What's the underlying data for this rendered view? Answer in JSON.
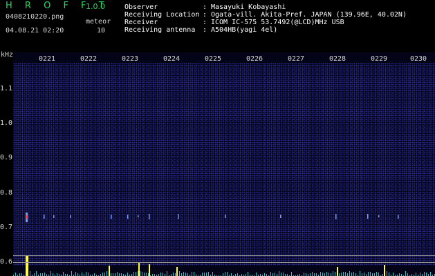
{
  "app": {
    "name": "H R O F F T",
    "version": "1.0.0"
  },
  "file": {
    "name": "0408210220.png",
    "timestamp": "04.08.21 02:20"
  },
  "meteor": {
    "label": "meteor",
    "count": "10"
  },
  "metadata": [
    {
      "label": "Observer",
      "value": "Masayuki Kobayashi"
    },
    {
      "label": "Receiving Location",
      "value": "Ogata-vill. Akita-Pref. JAPAN (139.96E, 40.02N)"
    },
    {
      "label": "Receiver",
      "value": "ICOM IC-575 53.7492(@LCD)MHz USB"
    },
    {
      "label": "Receiving antenna",
      "value": "A504HB(yagi 4el)"
    }
  ],
  "separator": ":",
  "spectrogram": {
    "unit_label": "kHz",
    "frequency_ticks": [
      "1.1",
      "1.0",
      "0.9",
      "0.8",
      "0.7",
      "0.6"
    ],
    "time_ticks": [
      "0221",
      "0222",
      "0223",
      "0224",
      "0225",
      "0226",
      "0227",
      "0228",
      "0229",
      "0230"
    ],
    "colors": {
      "background": "#040418",
      "noise": "#4646dc",
      "signal": "#6fa0ff",
      "histogram": "#27c7c7",
      "peak": "#ffff33",
      "meteor_head": "#ff3030"
    }
  }
}
